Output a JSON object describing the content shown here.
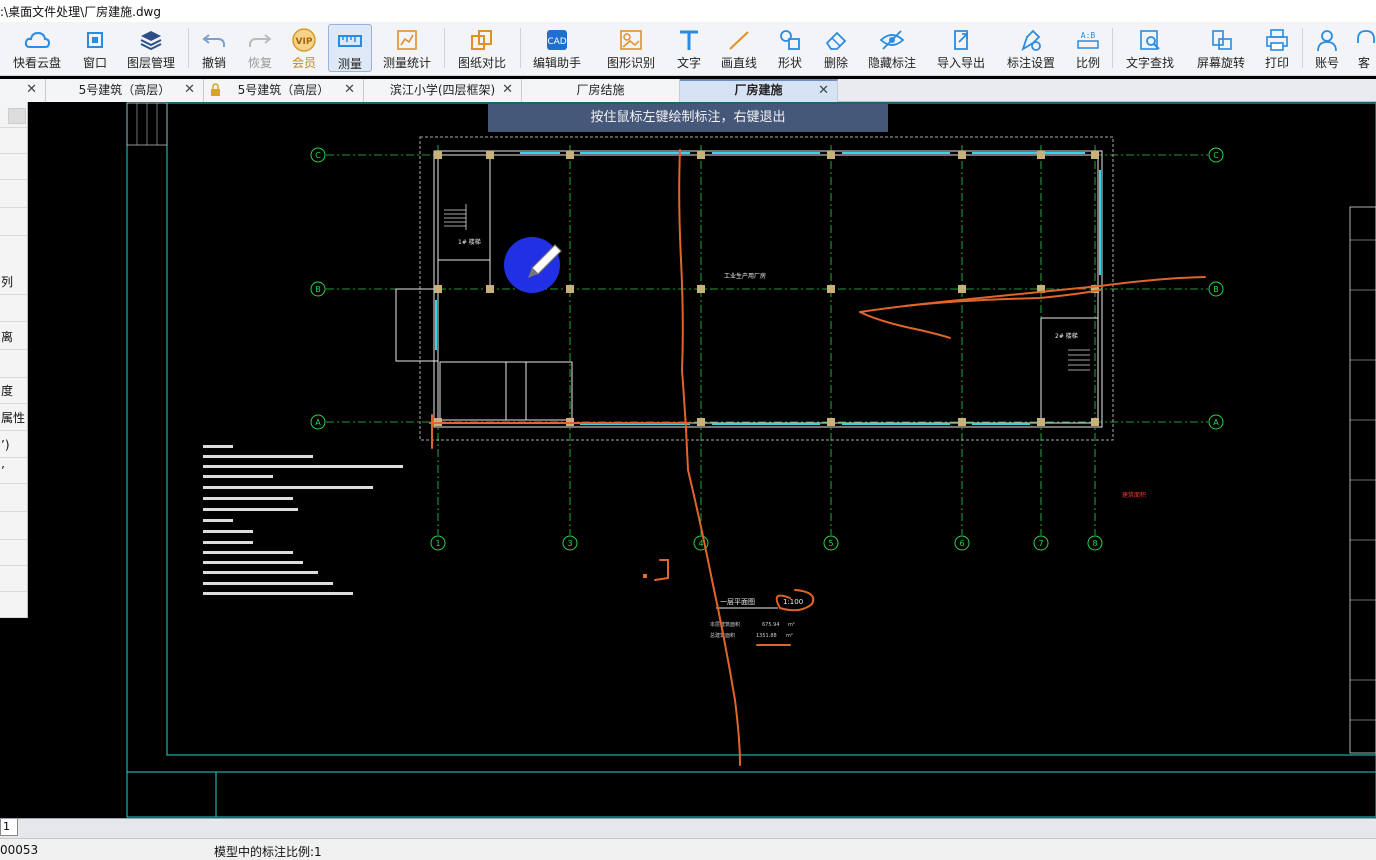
{
  "window": {
    "title": ":\\桌面文件处理\\厂房建施.dwg"
  },
  "toolbar": {
    "items": [
      {
        "label": "快看云盘",
        "icon": "cloud-icon"
      },
      {
        "label": "窗口",
        "icon": "window-icon"
      },
      {
        "label": "图层管理",
        "icon": "layers-icon"
      },
      {
        "label": "撤销",
        "icon": "undo-icon"
      },
      {
        "label": "恢复",
        "icon": "redo-icon"
      },
      {
        "label": "会员",
        "icon": "vip-icon"
      },
      {
        "label": "测量",
        "icon": "measure-icon"
      },
      {
        "label": "测量统计",
        "icon": "measure-stats-icon"
      },
      {
        "label": "图纸对比",
        "icon": "compare-icon"
      },
      {
        "label": "编辑助手",
        "icon": "edit-assistant-icon"
      },
      {
        "label": "图形识别",
        "icon": "shape-recognition-icon"
      },
      {
        "label": "文字",
        "icon": "text-icon"
      },
      {
        "label": "画直线",
        "icon": "line-icon"
      },
      {
        "label": "形状",
        "icon": "shape-icon"
      },
      {
        "label": "删除",
        "icon": "eraser-icon"
      },
      {
        "label": "隐藏标注",
        "icon": "eye-hide-icon"
      },
      {
        "label": "导入导出",
        "icon": "import-export-icon"
      },
      {
        "label": "标注设置",
        "icon": "annotation-settings-icon"
      },
      {
        "label": "比例",
        "icon": "scale-icon"
      },
      {
        "label": "文字查找",
        "icon": "text-search-icon"
      },
      {
        "label": "屏幕旋转",
        "icon": "rotate-screen-icon"
      },
      {
        "label": "打印",
        "icon": "print-icon"
      },
      {
        "label": "账号",
        "icon": "account-icon"
      },
      {
        "label": "客",
        "icon": "service-icon"
      }
    ]
  },
  "tabs": [
    {
      "label": ""
    },
    {
      "label": "5号建筑（高层）"
    },
    {
      "label": "5号建筑（高层）"
    },
    {
      "label": "滨江小学(四层框架)"
    },
    {
      "label": "厂房结施"
    },
    {
      "label": "厂房建施"
    }
  ],
  "leftpanel": {
    "rows": [
      "",
      "",
      "",
      "",
      "",
      "列",
      "",
      "离",
      "",
      "度",
      "属性",
      "’)",
      "’",
      "",
      "",
      "",
      "",
      "",
      ""
    ]
  },
  "hint": {
    "text": "按住鼠标左键绘制标注，右键退出"
  },
  "drawing": {
    "grid_rows": [
      "C",
      "B",
      "A"
    ],
    "grid_cols": [
      "1",
      "3",
      "4",
      "5",
      "6",
      "7",
      "8"
    ],
    "plan_title": "一层平面图",
    "scale_note": "1:100",
    "area_label_1": "本层建筑面积",
    "area_value_1": "675.94",
    "area_label_2": "总建筑面积",
    "area_value_2": "1351.88",
    "area_unit": "m²",
    "room_label": "1# 楼梯",
    "room_label_2": "2# 楼梯",
    "center_label": "工业生产用厂房",
    "legend_red": "建筑面积"
  },
  "layout": {
    "tab": "1"
  },
  "status": {
    "coords": "00053",
    "text": "模型中的标注比例:1"
  }
}
